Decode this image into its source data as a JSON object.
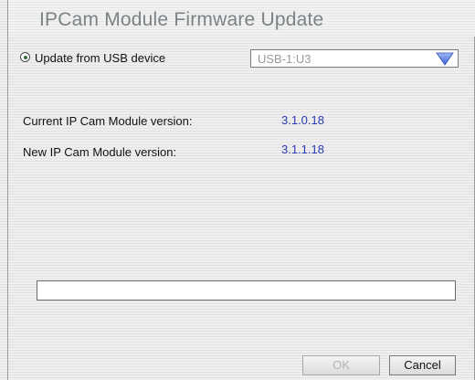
{
  "window": {
    "title": "IPCam Module Firmware Update"
  },
  "update_source": {
    "radio_label": "Update from USB device",
    "selected": true,
    "device_value": "USB-1:U3",
    "arrow_color": "#5a7fe0"
  },
  "versions": {
    "current_label": "Current IP Cam Module version:",
    "current_value": "3.1.0.18",
    "new_label": "New IP Cam Module version:",
    "new_value": "3.1.1.18"
  },
  "progress": {
    "value": 0
  },
  "buttons": {
    "ok_label": "OK",
    "ok_enabled": false,
    "cancel_label": "Cancel"
  }
}
